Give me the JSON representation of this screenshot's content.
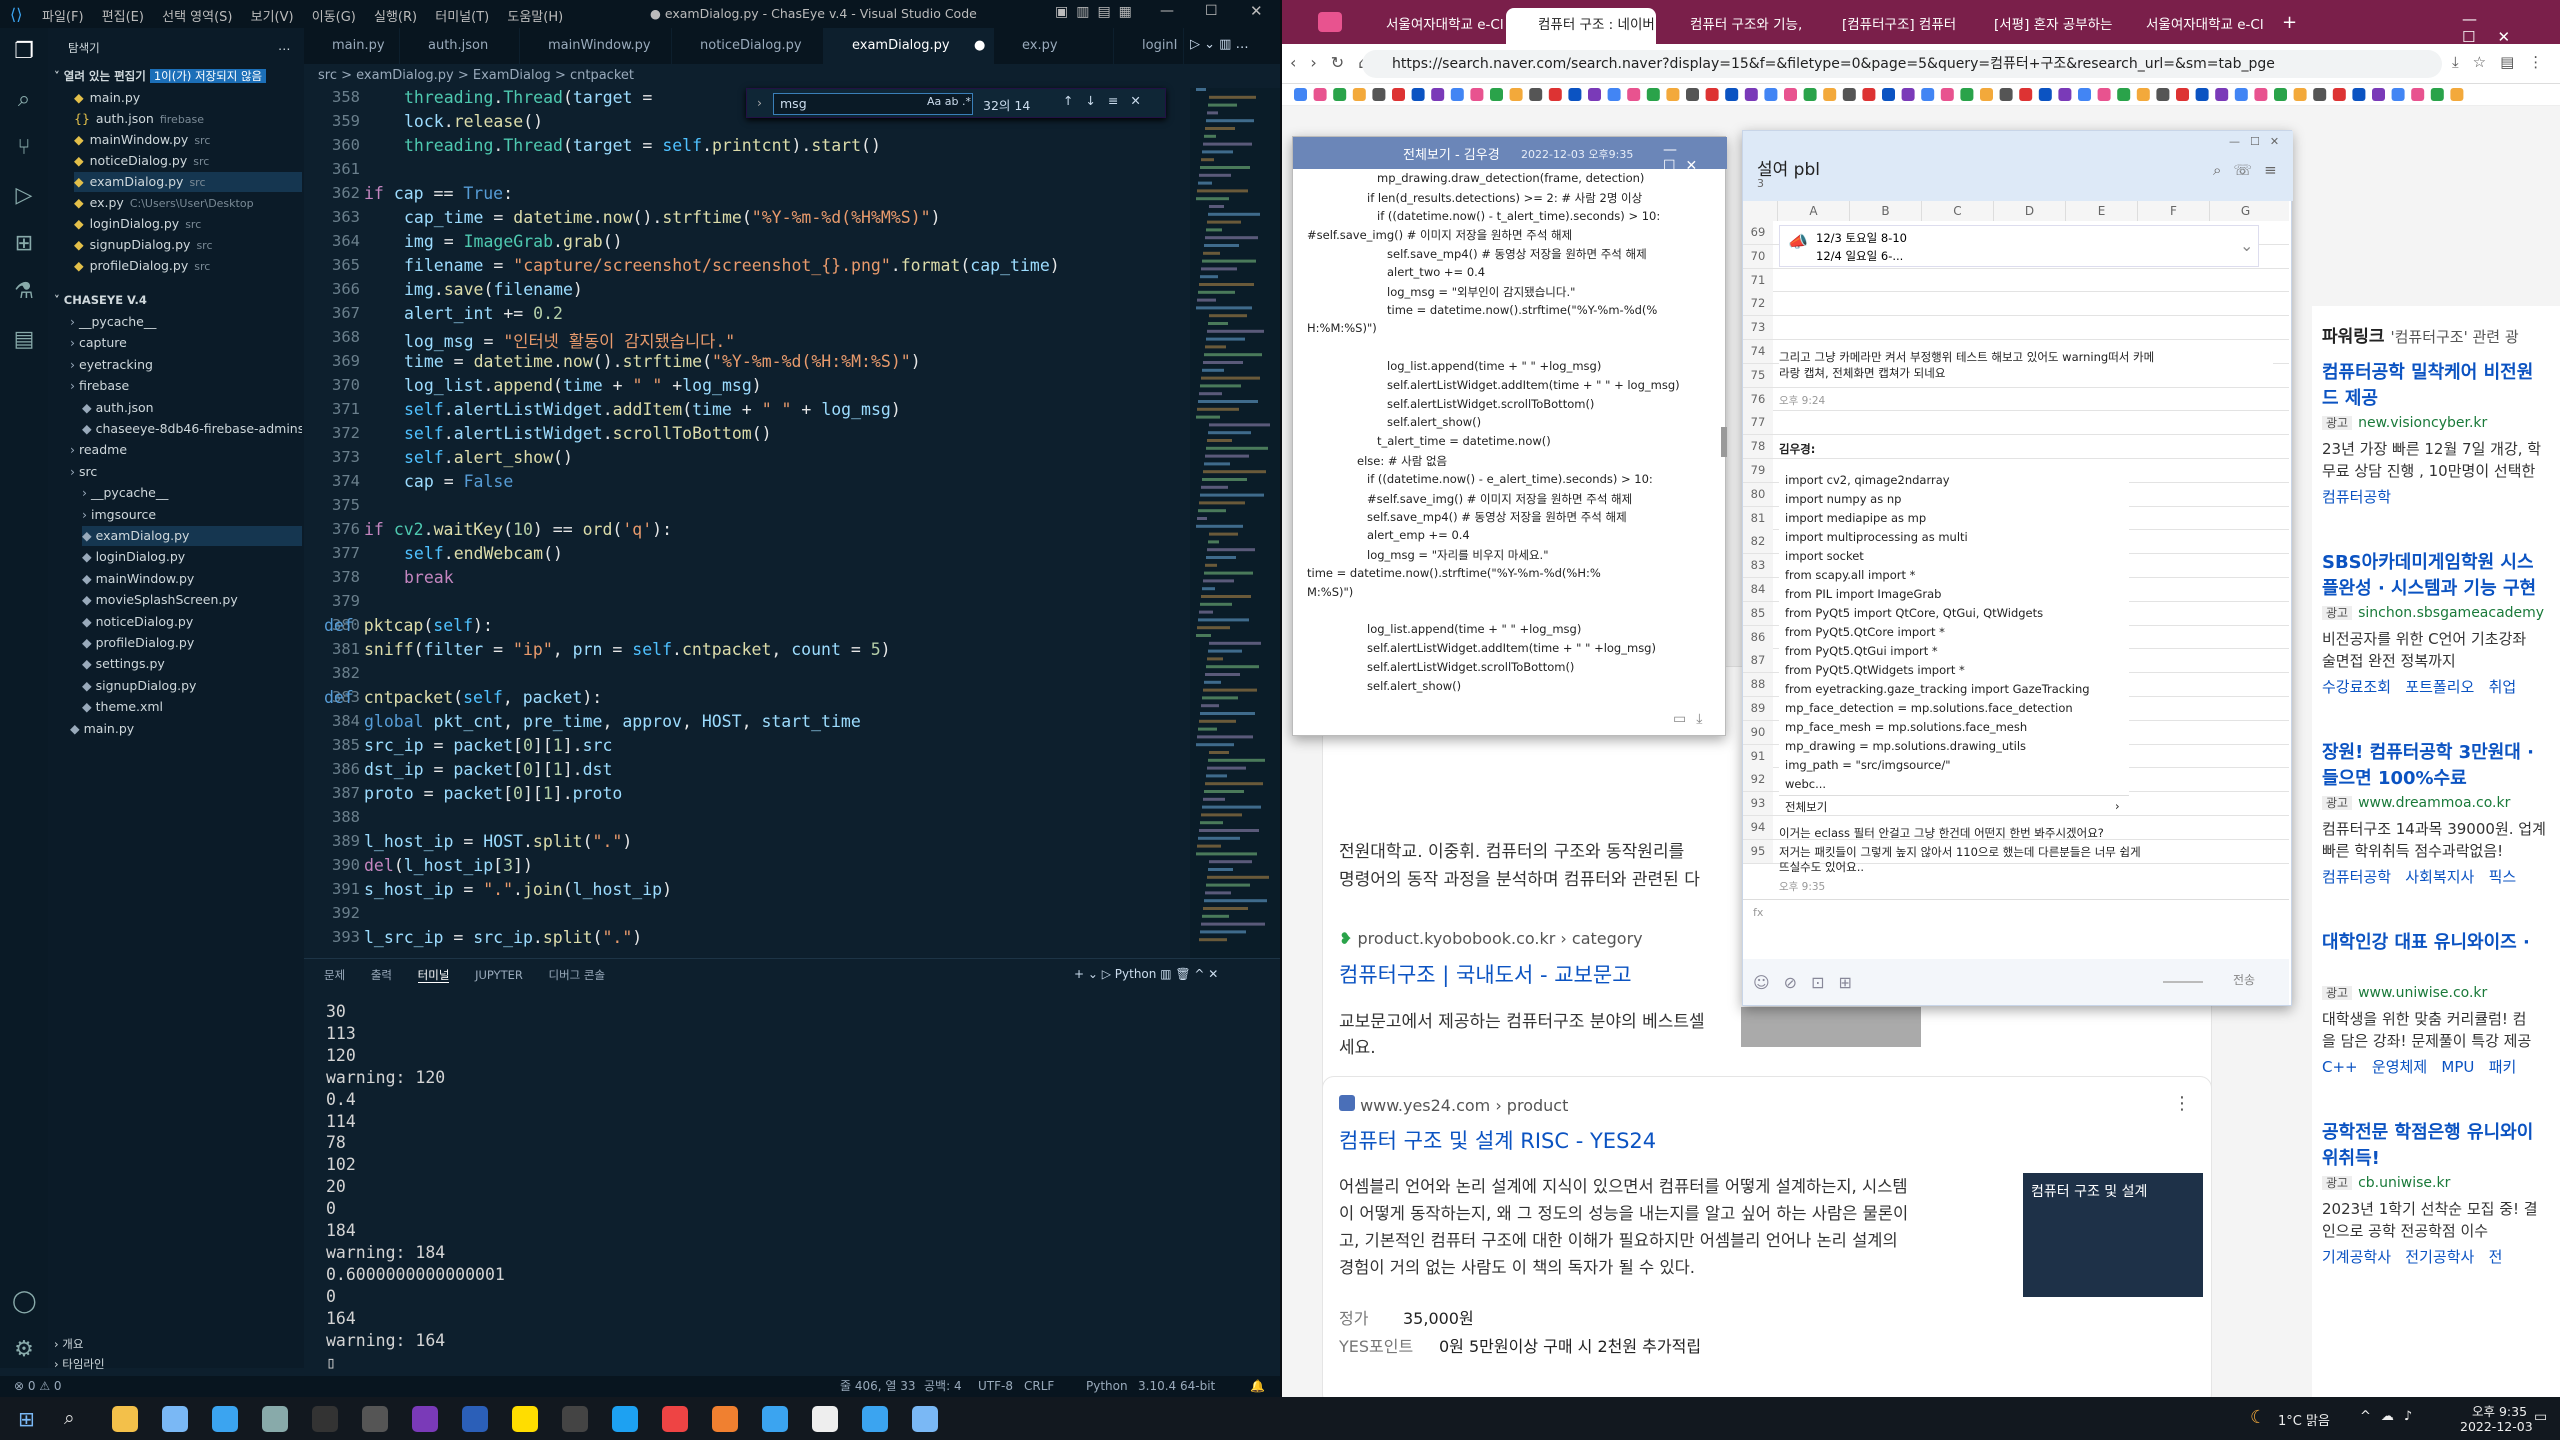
{
  "vscode": {
    "window_title": "● examDialog.py - ChasEye v.4 - Visual Studio Code",
    "menus": [
      "파일(F)",
      "편집(E)",
      "선택 영역(S)",
      "보기(V)",
      "이동(G)",
      "실행(R)",
      "터미널(T)",
      "도움말(H)"
    ],
    "explorer_title": "탐색기",
    "open_editors_label": "열려 있는 편집기",
    "unsaved_badge": "1이(가) 저장되지 않음",
    "open_editors": [
      {
        "name": "main.py",
        "hint": ""
      },
      {
        "name": "auth.json",
        "hint": "firebase"
      },
      {
        "name": "mainWindow.py",
        "hint": "src"
      },
      {
        "name": "noticeDialog.py",
        "hint": "src"
      },
      {
        "name": "examDialog.py",
        "hint": "src"
      },
      {
        "name": "ex.py",
        "hint": "C:\\Users\\User\\Desktop"
      },
      {
        "name": "loginDialog.py",
        "hint": "src"
      },
      {
        "name": "signupDialog.py",
        "hint": "src"
      },
      {
        "name": "profileDialog.py",
        "hint": "src"
      }
    ],
    "project_label": "CHASEYE V.4",
    "tree": [
      "__pycache__",
      "capture",
      "eyetracking",
      "firebase",
      "auth.json",
      "chaseeye-8db46-firebase-adminsd...",
      "readme",
      "src",
      "__pycache__",
      "imgsource",
      "examDialog.py",
      "loginDialog.py",
      "mainWindow.py",
      "movieSplashScreen.py",
      "noticeDialog.py",
      "profileDialog.py",
      "settings.py",
      "signupDialog.py",
      "theme.xml",
      "main.py"
    ],
    "outline_label": "개요",
    "timeline_label": "타임라인",
    "tabs": [
      "main.py",
      "auth.json",
      "mainWindow.py",
      "noticeDialog.py",
      "examDialog.py",
      "ex.py",
      "loginI"
    ],
    "breadcrumb": "src > examDialog.py > ExamDialog > cntpacket",
    "find": {
      "value": "msg",
      "count": "32의 14",
      "opts": "Aa  ab  .*"
    },
    "line_numbers": [
      "358",
      "359",
      "360",
      "361",
      "362",
      "363",
      "364",
      "365",
      "366",
      "367",
      "368",
      "369",
      "370",
      "371",
      "372",
      "373",
      "374",
      "375",
      "376",
      "377",
      "378",
      "379",
      "380",
      "381",
      "382",
      "383",
      "384",
      "385",
      "386",
      "387",
      "388",
      "389",
      "390",
      "391",
      "392",
      "393"
    ],
    "panel_tabs": [
      "문제",
      "출력",
      "터미널",
      "JUPYTER",
      "디버그 콘솔"
    ],
    "panel_python": "Python",
    "terminal": [
      "30",
      "113",
      "120",
      "warning: 120",
      "0.4",
      "114",
      "78",
      "102",
      "20",
      "0",
      "184",
      "warning: 184",
      "0.6000000000000001",
      "0",
      "164",
      "warning: 164"
    ],
    "status": {
      "left": "⊗ 0 ⚠ 0",
      "pos": "줄 406, 열 33",
      "spaces": "공백: 4",
      "enc": "UTF-8",
      "eol": "CRLF",
      "lang": "Python",
      "ver": "3.10.4 64-bit"
    }
  },
  "browser": {
    "tabs": [
      "서울여자대학교 e-Cl",
      "컴퓨터 구조 : 네이버",
      "컴퓨터 구조와 기능,",
      "[컴퓨터구조] 컴퓨터",
      "[서평] 혼자 공부하는",
      "서울여자대학교 e-Cl"
    ],
    "url": "https://search.naver.com/search.naver?display=15&f=&filetype=0&page=5&query=컴퓨터+구조&research_url=&sm=tab_pge",
    "results": [
      {
        "site": "product.kyobobook.co.kr › category",
        "title": "컴퓨터구조 | 국내도서 - 교보문고",
        "desc": "교보문고에서 제공하는 컴퓨터구조 분야의 베스트셀",
        "desc2": "세요.",
        "frag1": "전원대학교. 이중휘. 컴퓨터의 구조와 동작원리를",
        "frag2": "명령어의 동작 과정을 분석하며 컴퓨터와 관련된 다"
      },
      {
        "site": "www.yes24.com › product",
        "title": "컴퓨터 구조 및 설계 RISC - YES24",
        "desc": "어셈블리 언어와 논리 설계에 지식이 있으면서 컴퓨터를 어떻게 설계하는지, 시스템\n이 어떻게 동작하는지, 왜 그 정도의 성능을 내는지를 알고 싶어 하는 사람은 물론이\n고, 기본적인 컴퓨터 구조에 대한 이해가 필요하지만 어셈블리 언어나 논리 설계의\n경험이 거의 없는 사람도 이 책의 독자가 될 수 있다.",
        "price_label": "정가",
        "price": "35,000원",
        "points_label": "YES포인트",
        "points": "0원 5만원이상 구매 시 2천원 추가적립",
        "book_cover": "컴퓨터 구조 및 설계"
      }
    ],
    "powerlink": {
      "title": "파워링크",
      "query": "'컴퓨터구조' 관련 광",
      "ads": [
        {
          "title": "컴퓨터공학 밀착케어 비전원",
          "title2": "드 제공",
          "url": "new.visioncyber.kr",
          "desc": "23년 가장 빠른 12월 7일 개강, 학",
          "desc2": "무료 상담 진행 , 10만명이 선택한",
          "links": "컴퓨터공학"
        },
        {
          "title": "SBS아카데미게임학원 시스",
          "title2": "플완성 · 시스템과 기능 구현",
          "url": "sinchon.sbsgameacademy",
          "desc": "비전공자를 위한 C언어 기초강좌",
          "desc2": "술면접 완전 정복까지",
          "links": "수강료조회   포트폴리오   취업"
        },
        {
          "title": "장원! 컴퓨터공학 3만원대 ·",
          "title2": "들으면 100%수료",
          "url": "www.dreammoa.co.kr",
          "desc": "컴퓨터구조 14과목 39000원. 업계",
          "desc2": "빠른 학위취득 점수과락없음!",
          "links": "컴퓨터공학   사회복지사   픽스"
        },
        {
          "title": "대학인강 대표 유니와이즈 ·",
          "title2": "",
          "url": "www.uniwise.co.kr",
          "desc": "대학생을 위한 맞춤 커리큘럼! 컴",
          "desc2": "을 담은 강좌! 문제풀이 특강 제공",
          "links": "C++   운영체제   MPU   패키"
        },
        {
          "title": "공학전문 학점은행 유니와이",
          "title2": "위취득!",
          "url": "cb.uniwise.kr",
          "desc": "2023년 1학기 선착순 모집 중! 결",
          "desc2": "인으로 공학 전공학점 이수",
          "links": "기계공학사   전기공학사   전"
        }
      ],
      "ad_badge": "광고"
    }
  },
  "kakao_view": {
    "title": "전체보기 - 김우경",
    "date": "2022-12-03 오후9:35",
    "lines": [
      "mp_drawing.draw_detection(frame, detection)",
      "if len(d_results.detections) >= 2: # 사람 2명 이상",
      "if ((datetime.now() - t_alert_time).seconds) > 10:",
      "#self.save_img() # 이미지 저장을 원하면 주석 해제",
      "self.save_mp4() # 동영상 저장을 원하면 주석 해제",
      "alert_two += 0.4",
      "log_msg = \"외부인이 감지됐습니다.\"",
      "time = datetime.now().strftime(\"%Y-%m-%d(%",
      "H:%M:%S)\")",
      "",
      "log_list.append(time + \" \" +log_msg)",
      "self.alertListWidget.addItem(time + \" \" + log_msg)",
      "self.alertListWidget.scrollToBottom()",
      "self.alert_show()",
      "t_alert_time = datetime.now()",
      "else: # 사람 없음",
      "if ((datetime.now() - e_alert_time).seconds) > 10:",
      "#self.save_img() # 이미지 저장을 원하면 주석 해제",
      "self.save_mp4() # 동영상 저장을 원하면 주석 해제",
      "alert_emp += 0.4",
      "log_msg = \"자리를 비우지 마세요.\"",
      "time = datetime.now().strftime(\"%Y-%m-%d(%H:%",
      "M:%S)\")",
      "",
      "log_list.append(time + \" \" +log_msg)",
      "self.alertListWidget.addItem(time + \" \" +log_msg)",
      "self.alertListWidget.scrollToBottom()",
      "self.alert_show()",
      "e_alert_time = datetime.now()"
    ]
  },
  "kakao_chat": {
    "title": "설여 pbl",
    "members": "3",
    "cols": [
      "A",
      "B",
      "C",
      "D",
      "E",
      "F",
      "G"
    ],
    "rows": [
      "69",
      "70",
      "71",
      "72",
      "73",
      "74",
      "75",
      "76",
      "77",
      "78",
      "79",
      "80",
      "81",
      "82",
      "83",
      "84",
      "85",
      "86",
      "87",
      "88",
      "89",
      "90",
      "91",
      "92",
      "93",
      "94",
      "95"
    ],
    "notice1": "12/3 토요일 8-10",
    "notice2": "12/4 일요일 6-...",
    "msg1": "그리고 그냥 카메라만 켜서 부정행위 테스트 해보고 있어도 warning떠서 카메\n라랑 캡쳐, 전체화면 캡쳐가 되네요",
    "time1": "오후 9:24",
    "sender": "김우경:",
    "code": [
      "import cv2, qimage2ndarray",
      "import numpy as np",
      "import mediapipe as mp",
      "import multiprocessing as multi",
      "import socket",
      "from scapy.all import *",
      "from PIL import ImageGrab",
      "from PyQt5 import QtCore, QtGui, QtWidgets",
      "from PyQt5.QtCore import *",
      "from PyQt5.QtGui import *",
      "from PyQt5.QtWidgets import *",
      "from eyetracking.gaze_tracking import GazeTracking",
      "mp_face_detection = mp.solutions.face_detection",
      "mp_face_mesh = mp.solutions.face_mesh",
      "mp_drawing = mp.solutions.drawing_utils",
      "img_path = \"src/imgsource/\"",
      "webc..."
    ],
    "view_all": "전체보기",
    "msg2": "이거는 eclass 필터 안걸고 그냥 한건데 어떤지 한번 봐주시겠어요?",
    "msg3": "저거는 패킷들이 그렇게 높지 않아서 110으로 했는데 다른분들은 너무 쉽게\n뜨실수도 있어요..",
    "time2": "오후 9:35",
    "send_label": "전송"
  },
  "taskbar": {
    "weather": "1°C 맑음",
    "time": "오후 9:35",
    "date": "2022-12-03"
  }
}
